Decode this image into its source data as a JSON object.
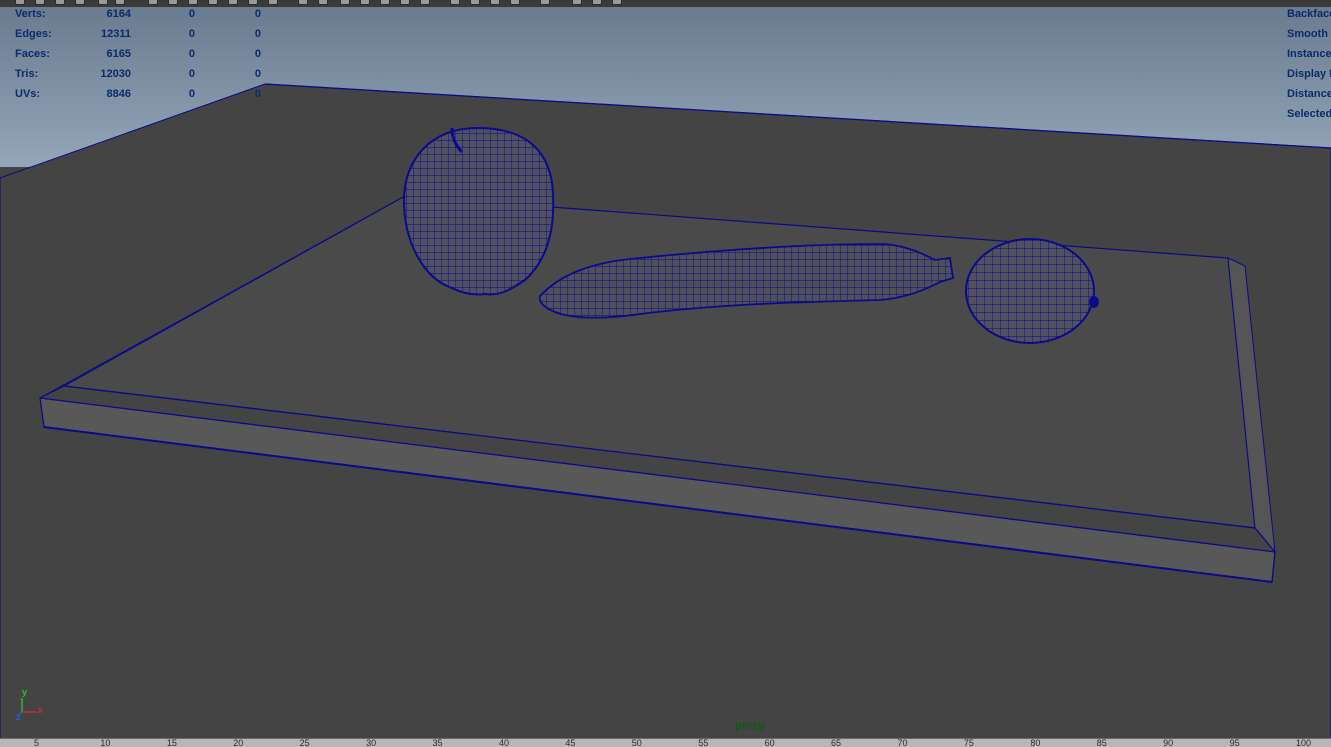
{
  "stats": {
    "rows": [
      {
        "label": "Verts:",
        "c1": "6164",
        "c2": "0",
        "c3": "0"
      },
      {
        "label": "Edges:",
        "c1": "12311",
        "c2": "0",
        "c3": "0"
      },
      {
        "label": "Faces:",
        "c1": "6165",
        "c2": "0",
        "c3": "0"
      },
      {
        "label": "Tris:",
        "c1": "12030",
        "c2": "0",
        "c3": "0"
      },
      {
        "label": "UVs:",
        "c1": "8846",
        "c2": "0",
        "c3": "0"
      }
    ]
  },
  "hud_right": [
    "Backface",
    "Smooth",
    "Instance",
    "Display I",
    "Distance",
    "Selected"
  ],
  "camera": "persp",
  "axis": {
    "y": "y",
    "z": "z",
    "x": "x"
  },
  "timeline": {
    "ticks": [
      "5",
      "10",
      "15",
      "20",
      "25",
      "30",
      "35",
      "40",
      "45",
      "50",
      "55",
      "60",
      "65",
      "70",
      "75",
      "80",
      "85",
      "90",
      "95",
      "100"
    ]
  },
  "colors": {
    "wire": "#0a0a8a",
    "hud_text": "#0b2b6b",
    "camera_text": "#0d5a12",
    "background": "#444444",
    "sky": "#8fa2b6"
  },
  "scene_objects": [
    "cutting-board",
    "apple",
    "banana",
    "lemon"
  ]
}
